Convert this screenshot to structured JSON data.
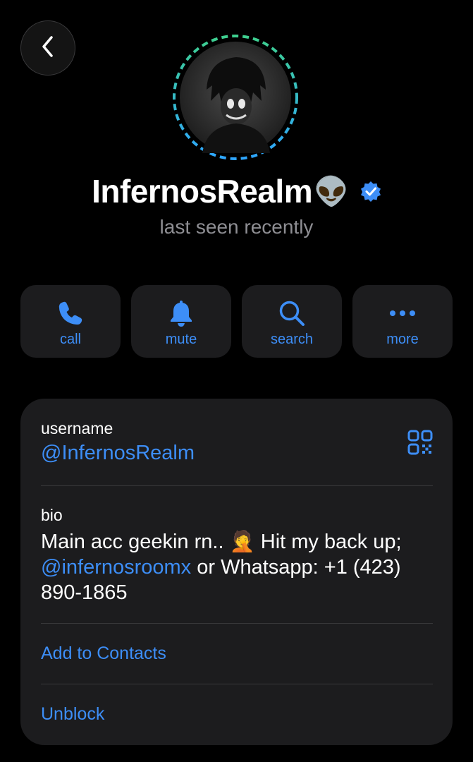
{
  "header": {
    "back_icon": "chevron-left-icon"
  },
  "profile": {
    "display_name": "InfernosRealm",
    "name_emoji": "👽",
    "verified_icon": "verified-badge-icon",
    "status": "last seen recently",
    "avatar_ring_colors": [
      "#3ecf8e",
      "#2ea6ff"
    ]
  },
  "actions": [
    {
      "label": "call",
      "icon": "phone-icon"
    },
    {
      "label": "mute",
      "icon": "bell-icon"
    },
    {
      "label": "search",
      "icon": "search-icon"
    },
    {
      "label": "more",
      "icon": "more-dots-icon"
    }
  ],
  "info": {
    "username_label": "username",
    "username_value": "@InfernosRealm",
    "qr_icon": "qr-code-icon",
    "bio_label": "bio",
    "bio_part1": "Main acc geekin rn.. ",
    "bio_emoji": "🤦",
    "bio_part2": " Hit my back up;",
    "bio_mention": "@infernosroomx",
    "bio_part3": " or Whatsapp: +1 (423) 890-1865",
    "add_contacts": "Add to Contacts",
    "unblock": "Unblock"
  },
  "colors": {
    "accent": "#3d8ef7",
    "background": "#000000",
    "card": "#1c1c1e",
    "secondary_text": "#8e8e93"
  }
}
